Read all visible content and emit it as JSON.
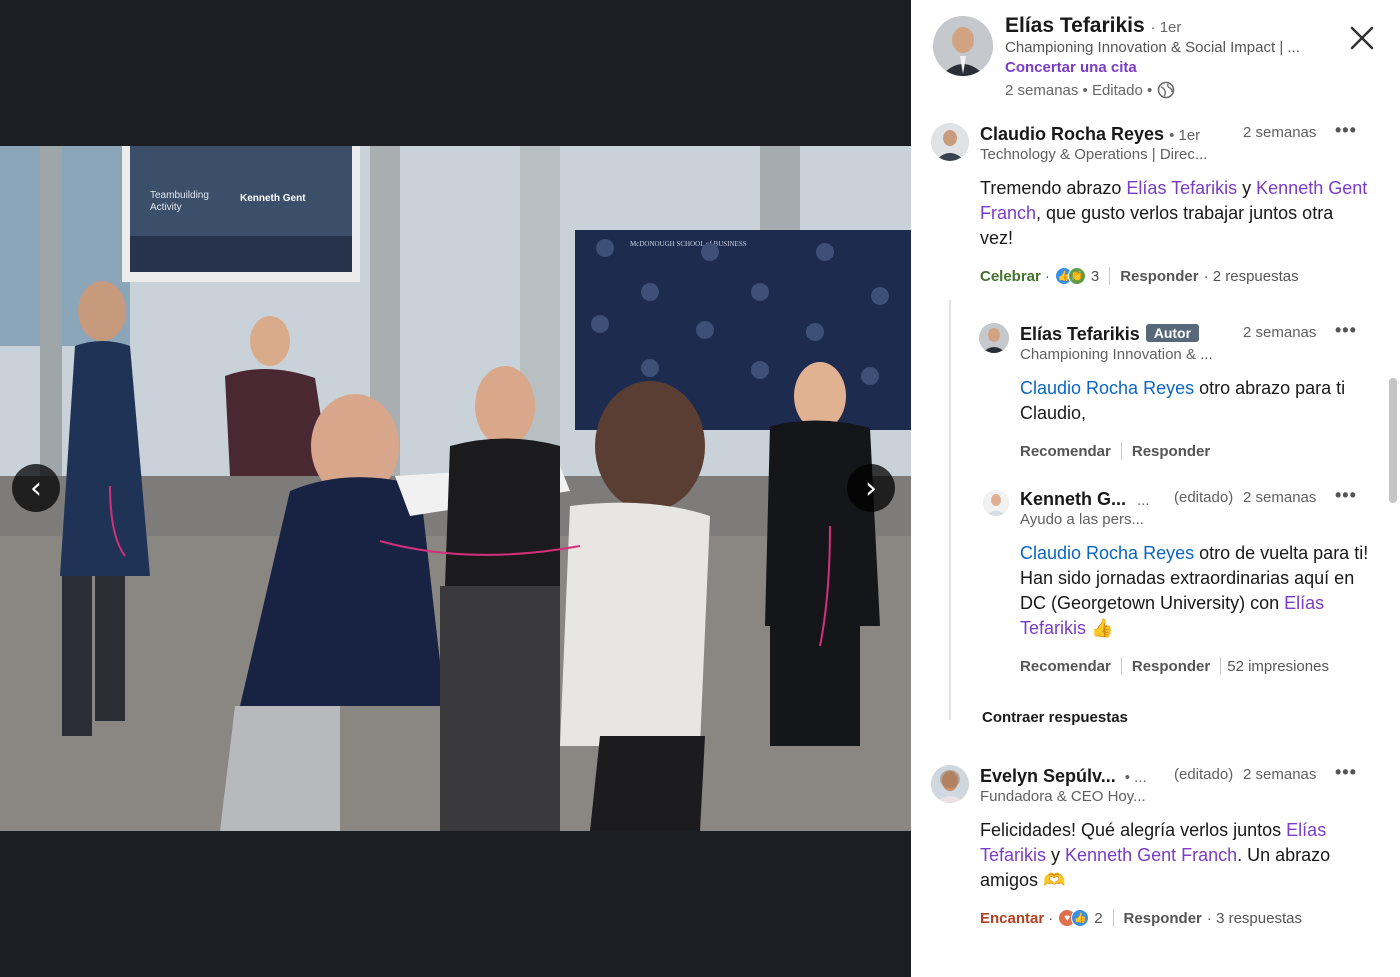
{
  "media": {
    "prev_arrow": "‹",
    "next_arrow": "›",
    "photo_screen_text": [
      "Teambuilding",
      "Activity",
      "Kenneth Gent"
    ],
    "backdrop_text": "McDONOUGH SCHOOL of BUSINESS"
  },
  "post_author": {
    "name": "Elías Tefarikis",
    "degree": "· 1er",
    "headline": "Championing Innovation & Social Impact | ...",
    "cta": "Concertar una cita",
    "meta": "2 semanas • Editado •"
  },
  "comments": [
    {
      "name": "Claudio Rocha Reyes",
      "degree": "• 1er",
      "headline": "Technology & Operations | Direc...",
      "time": "2 semanas",
      "text_parts": [
        "Tremendo abrazo ",
        "Elías Tefarikis",
        " y ",
        "Kenneth Gent Franch",
        ", que gusto verlos trabajar juntos otra vez!"
      ],
      "reaction_label": "Celebrar",
      "reaction_count": "3",
      "reply_label": "Responder",
      "replies_count": "· 2 respuestas"
    },
    {
      "name": "Elías Tefarikis",
      "badge": "Autor",
      "headline": "Championing Innovation & ...",
      "time": "2 semanas",
      "text_parts": [
        "Claudio Rocha Reyes",
        " otro abrazo para ti Claudio,"
      ],
      "like_label": "Recomendar",
      "reply_label": "Responder"
    },
    {
      "name": "Kenneth G...",
      "degree_trunc": "...",
      "edited": "(editado)",
      "headline": "Ayudo a las pers...",
      "time": "2 semanas",
      "text_parts": [
        "Claudio Rocha Reyes",
        " otro de vuelta para ti! Han sido jornadas extraordinarias aquí en DC (Georgetown University) con ",
        "Elías Tefarikis",
        " 👍"
      ],
      "like_label": "Recomendar",
      "reply_label": "Responder",
      "impressions": "52 impresiones"
    },
    {
      "name": "Evelyn Sepúlv...",
      "degree_trunc": "• ...",
      "edited": "(editado)",
      "headline": "Fundadora & CEO Hoy...",
      "time": "2 semanas",
      "text_parts": [
        "Felicidades! Qué alegría verlos juntos ",
        "Elías Tefarikis",
        " y ",
        "Kenneth Gent Franch",
        ". Un abrazo amigos 🫶"
      ],
      "reaction_label": "Encantar",
      "reaction_count": "2",
      "reply_label": "Responder",
      "replies_count": "· 3 respuestas"
    }
  ],
  "collapse_label": "Contraer respuestas",
  "more_label": "•••",
  "colors": {
    "mention": "#7a3cc9",
    "mention_reply": "#0a66c2",
    "celebrar": "#44712e",
    "encantar": "#b24020"
  }
}
